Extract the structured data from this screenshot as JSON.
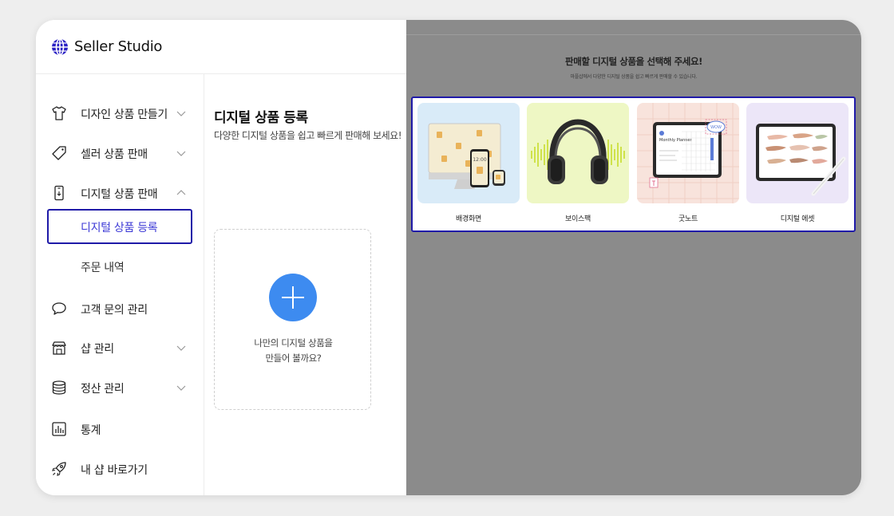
{
  "app": {
    "title": "Seller Studio"
  },
  "sidebar": {
    "items": [
      {
        "label": "디자인 상품 만들기",
        "icon": "tshirt-icon",
        "expanded": false
      },
      {
        "label": "셀러 상품 판매",
        "icon": "tag-icon",
        "expanded": false
      },
      {
        "label": "디지털 상품 판매",
        "icon": "phone-icon",
        "expanded": true,
        "children": [
          {
            "label": "디지털 상품 등록",
            "active": true
          },
          {
            "label": "주문 내역",
            "active": false
          }
        ]
      },
      {
        "label": "고객 문의 관리",
        "icon": "chat-bubble-icon"
      },
      {
        "label": "샵 관리",
        "icon": "store-icon",
        "expanded": false
      },
      {
        "label": "정산 관리",
        "icon": "database-icon",
        "expanded": false
      },
      {
        "label": "통계",
        "icon": "bar-chart-icon"
      },
      {
        "label": "내 샵 바로가기",
        "icon": "rocket-icon"
      }
    ]
  },
  "main": {
    "title": "디지털 상품 등록",
    "subtitle": "다양한 디지털 상품을 쉽고 빠르게 판매해 보세요!",
    "add_card": {
      "line1": "나만의 디지털 상품을",
      "line2": "만들어 볼까요?"
    }
  },
  "overlay": {
    "heading": "판매할 디지털 상품을 선택해 주세요!",
    "subheading": "마플샵에서 다양한 디지털 상품을 쉽고 빠르게 판매할 수 있습니다.",
    "options": [
      {
        "label": "배경화면",
        "image": "wallpaper-devices-image",
        "bg": "#d9ebf8"
      },
      {
        "label": "보이스팩",
        "image": "headphones-image",
        "bg": "#eef7c4"
      },
      {
        "label": "굿노트",
        "image": "tablet-planner-image",
        "bg": "#f8e3dc",
        "planner_title": "Monthly Planner",
        "sticker": "WOW"
      },
      {
        "label": "디지털 에셋",
        "image": "tablet-brush-strokes-image",
        "bg": "#ece6f8"
      }
    ]
  },
  "colors": {
    "accent": "#3d8bf0",
    "highlight_border": "#1f1aa8",
    "active_text": "#3d3ad6",
    "overlay": "#8b8b8b"
  }
}
